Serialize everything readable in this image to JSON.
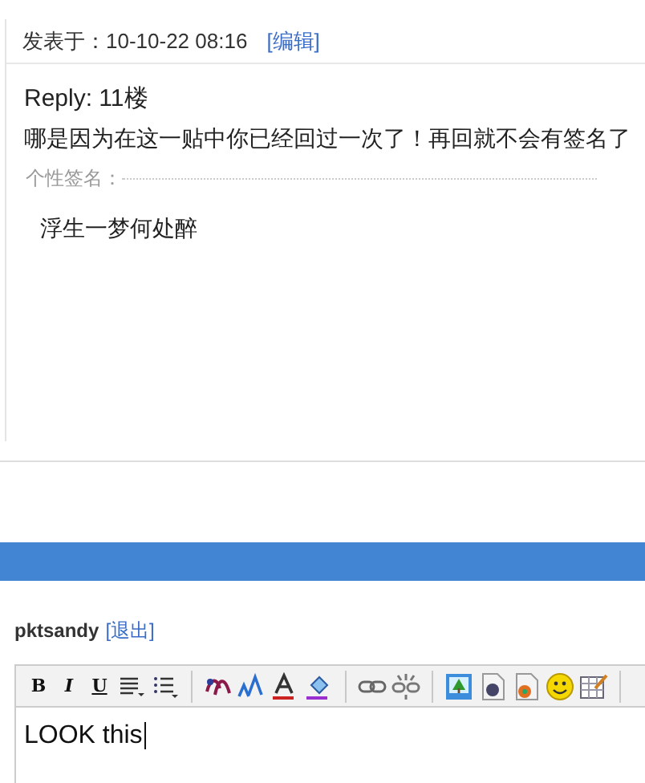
{
  "post": {
    "posted_label": "发表于：",
    "posted_time": "10-10-22 08:16",
    "edit_link": "[编辑]",
    "reply_title": "Reply: 11楼",
    "body": "哪是因为在这一贴中你已经回过一次了！再回就不会有签名了",
    "signature_label": "个性签名：",
    "signature": "浮生一梦何处醉"
  },
  "user": {
    "name": "pktsandy",
    "logout_link": "[退出]"
  },
  "editor": {
    "format_buttons": [
      "B",
      "I",
      "U"
    ],
    "value": "LOOK this"
  }
}
